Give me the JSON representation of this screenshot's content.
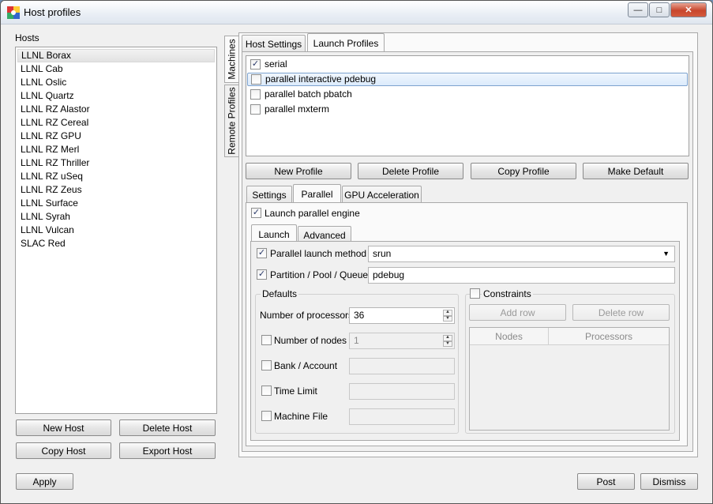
{
  "window": {
    "title": "Host profiles"
  },
  "hosts": {
    "label": "Hosts",
    "items": [
      "LLNL Borax",
      "LLNL Cab",
      "LLNL Oslic",
      "LLNL Quartz",
      "LLNL RZ Alastor",
      "LLNL RZ Cereal",
      "LLNL RZ GPU",
      "LLNL RZ Merl",
      "LLNL RZ Thriller",
      "LLNL RZ uSeq",
      "LLNL RZ Zeus",
      "LLNL Surface",
      "LLNL Syrah",
      "LLNL Vulcan",
      "SLAC Red"
    ],
    "selected": "LLNL Borax",
    "buttons": {
      "new": "New Host",
      "delete": "Delete Host",
      "copy": "Copy Host",
      "export": "Export Host"
    }
  },
  "side_tabs": {
    "machines": "Machines",
    "remote": "Remote Profiles"
  },
  "top_tabs": {
    "host_settings": "Host Settings",
    "launch_profiles": "Launch Profiles"
  },
  "profiles": {
    "items": [
      {
        "label": "serial",
        "checked": true
      },
      {
        "label": "parallel interactive pdebug",
        "checked": false
      },
      {
        "label": "parallel batch pbatch",
        "checked": false
      },
      {
        "label": "parallel mxterm",
        "checked": false
      }
    ],
    "buttons": {
      "new": "New Profile",
      "delete": "Delete Profile",
      "copy": "Copy Profile",
      "default": "Make Default"
    }
  },
  "profile_tabs": {
    "settings": "Settings",
    "parallel": "Parallel",
    "gpu": "GPU Acceleration"
  },
  "parallel": {
    "launch_engine_label": "Launch parallel engine",
    "tabs": {
      "launch": "Launch",
      "advanced": "Advanced"
    },
    "launch_method_label": "Parallel launch method",
    "launch_method_value": "srun",
    "partition_label": "Partition / Pool / Queue",
    "partition_value": "pdebug",
    "defaults": {
      "title": "Defaults",
      "num_processors_label": "Number of processors",
      "num_processors_value": "36",
      "num_nodes_label": "Number of nodes",
      "num_nodes_value": "1",
      "bank_label": "Bank / Account",
      "time_limit_label": "Time Limit",
      "machine_file_label": "Machine File"
    },
    "constraints": {
      "title": "Constraints",
      "add_row": "Add row",
      "delete_row": "Delete row",
      "columns": [
        "Nodes",
        "Processors"
      ]
    }
  },
  "footer": {
    "apply": "Apply",
    "post": "Post",
    "dismiss": "Dismiss"
  }
}
